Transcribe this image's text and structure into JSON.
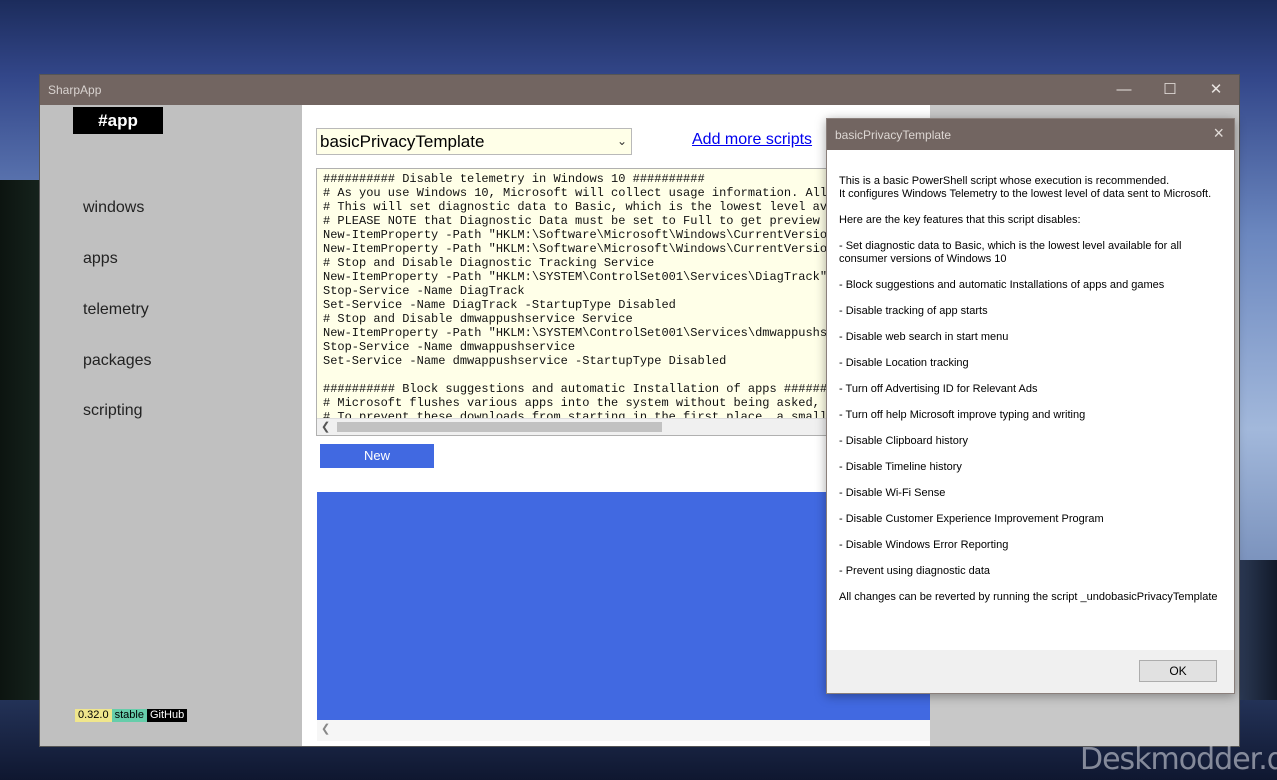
{
  "window": {
    "title": "SharpApp"
  },
  "sidebar": {
    "brand": "#app",
    "items": [
      {
        "label": "windows"
      },
      {
        "label": "apps"
      },
      {
        "label": "telemetry"
      },
      {
        "label": "packages"
      },
      {
        "label": "scripting"
      }
    ],
    "badges": {
      "version": "0.32.0",
      "channel": "stable",
      "github": "GitHub"
    }
  },
  "main": {
    "selected_script": "basicPrivacyTemplate",
    "add_more_link": "Add more scripts",
    "script_text": "########## Disable telemetry in Windows 10 ##########\n# As you use Windows 10, Microsoft will collect usage information. All i\n# This will set diagnostic data to Basic, which is the lowest level avai\n# PLEASE NOTE that Diagnostic Data must be set to Full to get preview bu\nNew-ItemProperty -Path \"HKLM:\\Software\\Microsoft\\Windows\\CurrentVersion\\\nNew-ItemProperty -Path \"HKLM:\\Software\\Microsoft\\Windows\\CurrentVersion\\\n# Stop and Disable Diagnostic Tracking Service\nNew-ItemProperty -Path \"HKLM:\\SYSTEM\\ControlSet001\\Services\\DiagTrack\" -\nStop-Service -Name DiagTrack\nSet-Service -Name DiagTrack -StartupType Disabled\n# Stop and Disable dmwappushservice Service\nNew-ItemProperty -Path \"HKLM:\\SYSTEM\\ControlSet001\\Services\\dmwappushsvc\nStop-Service -Name dmwappushservice\nSet-Service -Name dmwappushservice -StartupType Disabled\n\n########## Block suggestions and automatic Installation of apps ########\n# Microsoft flushes various apps into the system without being asked, es\n# To prevent these downloads from starting in the first place, a small i",
    "new_button": "New"
  },
  "dialog": {
    "title": "basicPrivacyTemplate",
    "body": "This is a basic PowerShell script whose execution is recommended.\nIt configures Windows Telemetry to the lowest level of data sent to Microsoft.\n\nHere are the key features that this script disables:\n\n- Set diagnostic data to Basic, which is the lowest level available for all consumer versions of Windows 10\n\n- Block suggestions and automatic Installations of apps and games\n\n- Disable tracking of app starts\n\n- Disable web search in start menu\n\n- Disable Location tracking\n\n- Turn off Advertising ID for Relevant Ads\n\n- Turn off help Microsoft improve typing and writing\n\n- Disable Clipboard history\n\n- Disable Timeline history\n\n- Disable Wi-Fi Sense\n\n- Disable Customer Experience Improvement Program\n\n- Disable Windows Error Reporting\n\n- Prevent using diagnostic data\n\nAll changes can be reverted by running the script _undobasicPrivacyTemplate",
    "ok_label": "OK"
  },
  "watermark": "Deskmodder.de",
  "colors": {
    "titlebar": "#726561",
    "accent": "#4169e1",
    "sidebar": "#c0c0c0",
    "editor_bg": "#ffffe8"
  }
}
